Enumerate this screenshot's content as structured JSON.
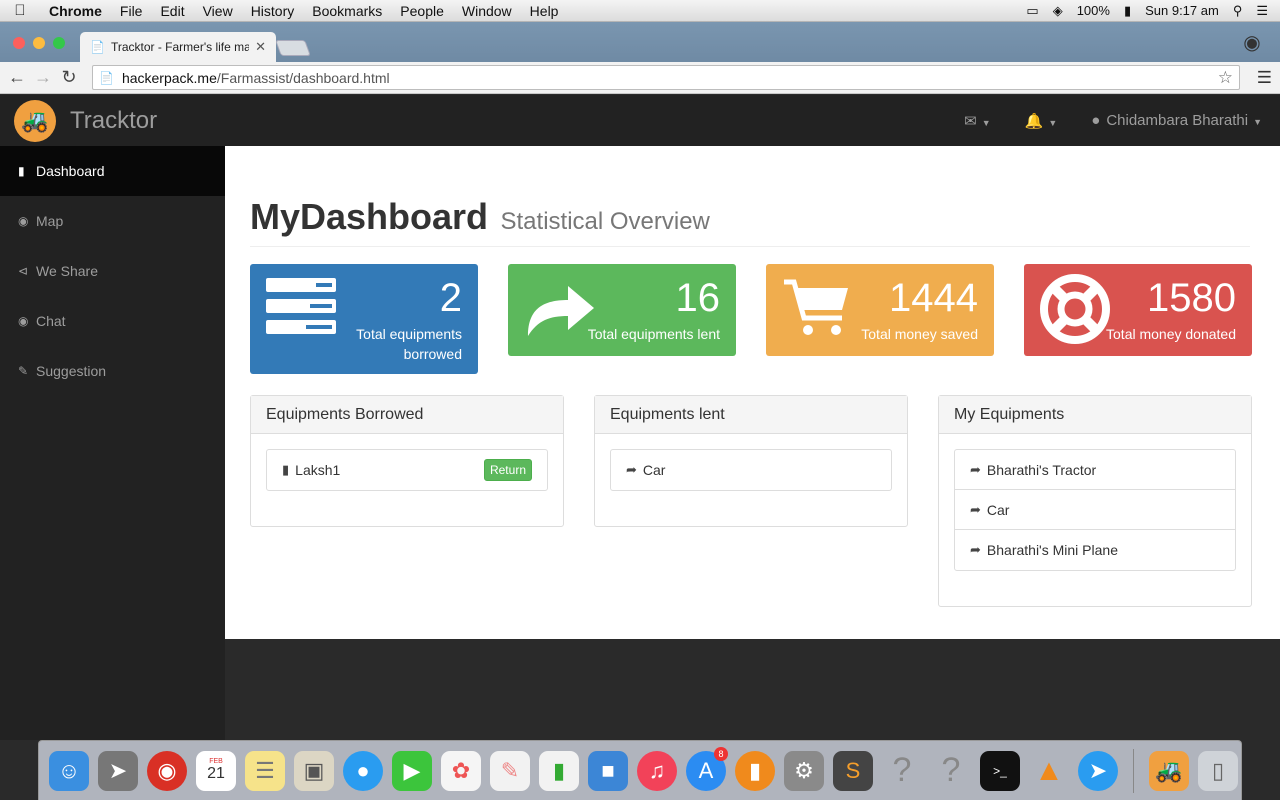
{
  "menubar": {
    "app": "Chrome",
    "items": [
      "File",
      "Edit",
      "View",
      "History",
      "Bookmarks",
      "People",
      "Window",
      "Help"
    ],
    "battery": "100%",
    "clock": "Sun 9:17 am"
  },
  "browser": {
    "tab_title": "Tracktor - Farmer's life ma",
    "url_host": "hackerpack.me",
    "url_path": "/Farmassist/dashboard.html"
  },
  "app": {
    "brand": "Tracktor",
    "user": "Chidambara Bharathi"
  },
  "sidebar": {
    "items": [
      {
        "label": "Dashboard",
        "icon": "bar-chart-icon"
      },
      {
        "label": "Map",
        "icon": "map-marker-icon"
      },
      {
        "label": "We Share",
        "icon": "share-icon"
      },
      {
        "label": "Chat",
        "icon": "comments-icon"
      },
      {
        "label": "Suggestion",
        "icon": "pencil-icon"
      }
    ]
  },
  "page": {
    "title": "MyDashboard",
    "subtitle": "Statistical Overview"
  },
  "stats": [
    {
      "value": "2",
      "label": "Total equipments borrowed",
      "color": "#337ab7",
      "icon": "tasks-icon"
    },
    {
      "value": "16",
      "label": "Total equipments lent",
      "color": "#5cb85c",
      "icon": "share-arrow-icon"
    },
    {
      "value": "1444",
      "label": "Total money saved",
      "color": "#f0ad4e",
      "icon": "shopping-cart-icon"
    },
    {
      "value": "1580",
      "label": "Total money donated",
      "color": "#d9534f",
      "icon": "life-ring-icon"
    }
  ],
  "panels": {
    "borrowed": {
      "title": "Equipments Borrowed",
      "items": [
        "Laksh1"
      ],
      "return_label": "Return"
    },
    "lent": {
      "title": "Equipments lent",
      "items": [
        "Car"
      ]
    },
    "mine": {
      "title": "My Equipments",
      "items": [
        "Bharathi's Tractor",
        "Car",
        "Bharathi's Mini Plane"
      ]
    }
  },
  "dock": {
    "appstore_badge": "8",
    "calendar_month": "FEB",
    "calendar_day": "21"
  }
}
